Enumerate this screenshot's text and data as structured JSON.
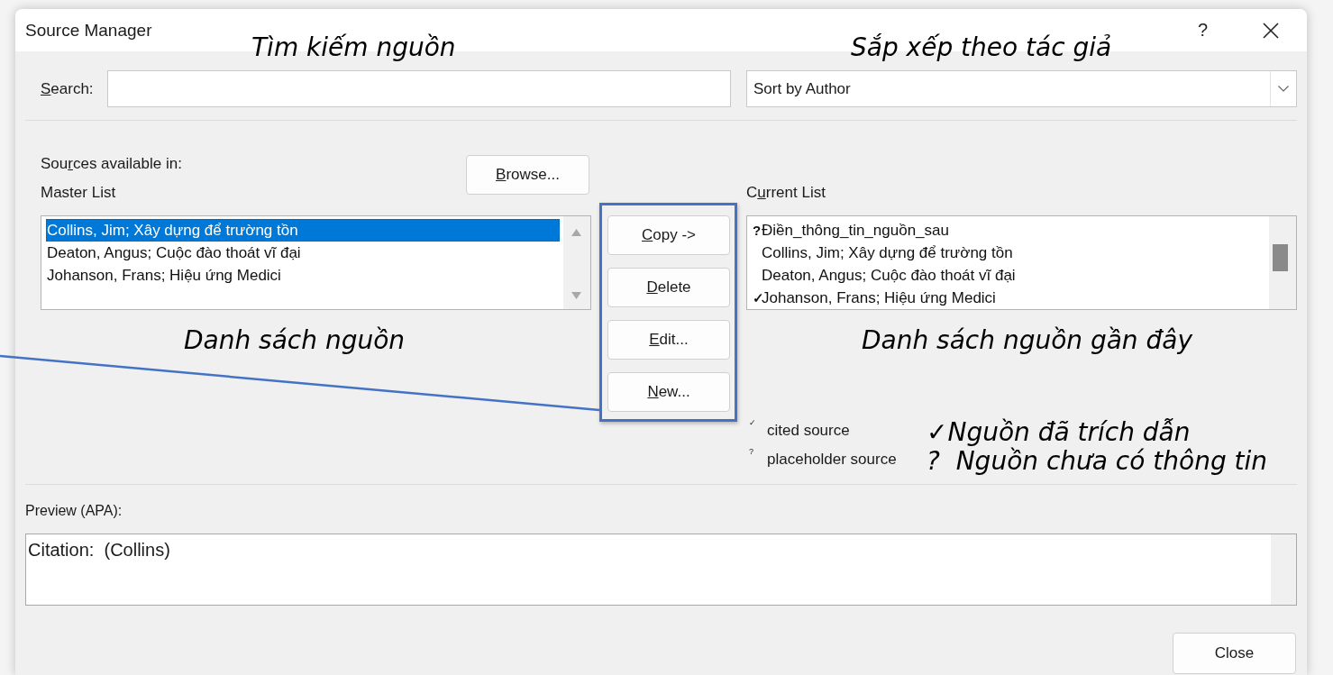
{
  "window": {
    "title": "Source Manager",
    "help": "?"
  },
  "search": {
    "label": {
      "key": "S",
      "post": "earch:"
    }
  },
  "sort": {
    "value": "Sort by Author"
  },
  "sources_available": {
    "label": {
      "pre": "Sou",
      "key": "r",
      "post": "ces available in:"
    }
  },
  "browse_button": {
    "key": "B",
    "post": "rowse..."
  },
  "master_list": {
    "label": {
      "post": "Master List"
    },
    "items": [
      {
        "text": "Collins, Jim; Xây dựng để trường tồn",
        "selected": true
      },
      {
        "text": "Deaton, Angus; Cuộc đào thoát vĩ đại",
        "selected": false
      },
      {
        "text": "Johanson, Frans; Hiệu ứng Medici",
        "selected": false
      }
    ]
  },
  "buttons": [
    {
      "key": "C",
      "post": "opy ->"
    },
    {
      "key": "D",
      "post": "elete"
    },
    {
      "key": "E",
      "post": "dit..."
    },
    {
      "key": "N",
      "post": "ew..."
    }
  ],
  "current_list": {
    "label": {
      "pre": "C",
      "key": "u",
      "post": "rrent List"
    },
    "items": [
      {
        "mark": "?",
        "text": "Điền_thông_tin_nguồn_sau",
        "selected": false
      },
      {
        "text": "Collins, Jim; Xây dựng để trường tồn",
        "selected": false
      },
      {
        "text": "Deaton, Angus; Cuộc đào thoát vĩ đại",
        "selected": false
      },
      {
        "mark": "✓",
        "text": "Johanson, Frans; Hiệu ứng Medici",
        "selected": false
      }
    ]
  },
  "legend": [
    {
      "mark": "✓",
      "label": "cited source"
    },
    {
      "mark": "?",
      "label": "placeholder source"
    }
  ],
  "preview": {
    "label": "Preview (APA):",
    "text": "Citation:  (Collins)"
  },
  "close_button": "Close",
  "annotations": [
    {
      "text": "Tìm kiếm nguồn"
    },
    {
      "text": "Sắp xếp theo tác giả"
    },
    {
      "text": "Danh sách nguồn"
    },
    {
      "text": "Danh sách nguồn gần đây"
    },
    {
      "text": "✓Nguồn đã trích dẫn"
    },
    {
      "text": "?  Nguồn chưa có thông tin"
    }
  ]
}
